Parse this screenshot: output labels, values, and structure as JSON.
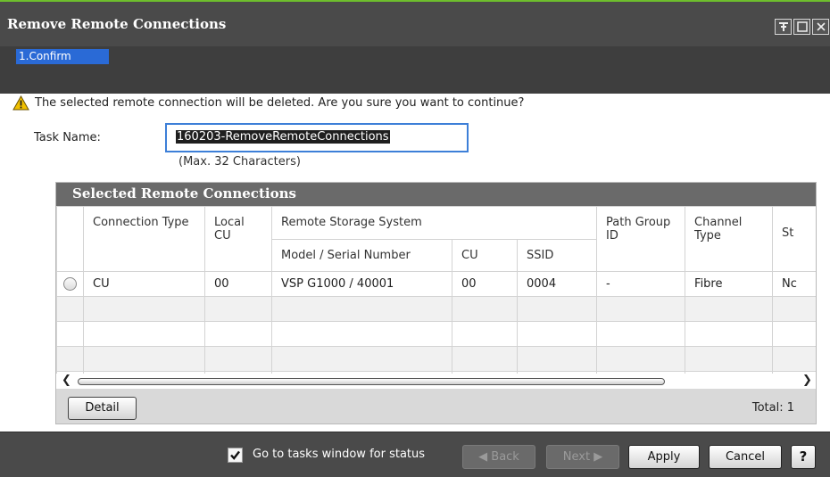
{
  "window": {
    "title": "Remove Remote Connections",
    "controls": [
      "pin-icon",
      "maximize-icon",
      "close-icon"
    ]
  },
  "steps": [
    {
      "label": "1.Confirm",
      "active": true
    }
  ],
  "warning": {
    "icon": "warning-icon",
    "text": "The selected remote connection will be deleted. Are you sure you want to continue?"
  },
  "task": {
    "label": "Task Name:",
    "value": "160203-RemoveRemoteConnections",
    "hint": "(Max. 32 Characters)"
  },
  "table": {
    "title": "Selected Remote Connections",
    "columns": {
      "connection_type": "Connection Type",
      "local_cu": "Local CU",
      "remote_group": "Remote Storage System",
      "model_serial": "Model / Serial Number",
      "cu": "CU",
      "ssid": "SSID",
      "path_group_id": "Path Group ID",
      "channel_type": "Channel Type",
      "status": "St"
    },
    "rows": [
      {
        "connection_type": "CU",
        "local_cu": "00",
        "model_serial": "VSP G1000 / 40001",
        "cu": "00",
        "ssid": "0004",
        "path_group_id": "-",
        "channel_type": "Fibre",
        "status": "Nc"
      }
    ],
    "detail_label": "Detail",
    "total_label": "Total:  1"
  },
  "footer": {
    "checkbox_label": "Go to tasks window for status",
    "checkbox_checked": true,
    "back_label": "◀ Back",
    "next_label": "Next ▶",
    "apply_label": "Apply",
    "cancel_label": "Cancel",
    "help_label": "?"
  },
  "colors": {
    "accent": "#2a6ad6",
    "titlebar": "#4a4a4a",
    "top_strip": "#6ebe2d",
    "warning": "#f0c000"
  }
}
